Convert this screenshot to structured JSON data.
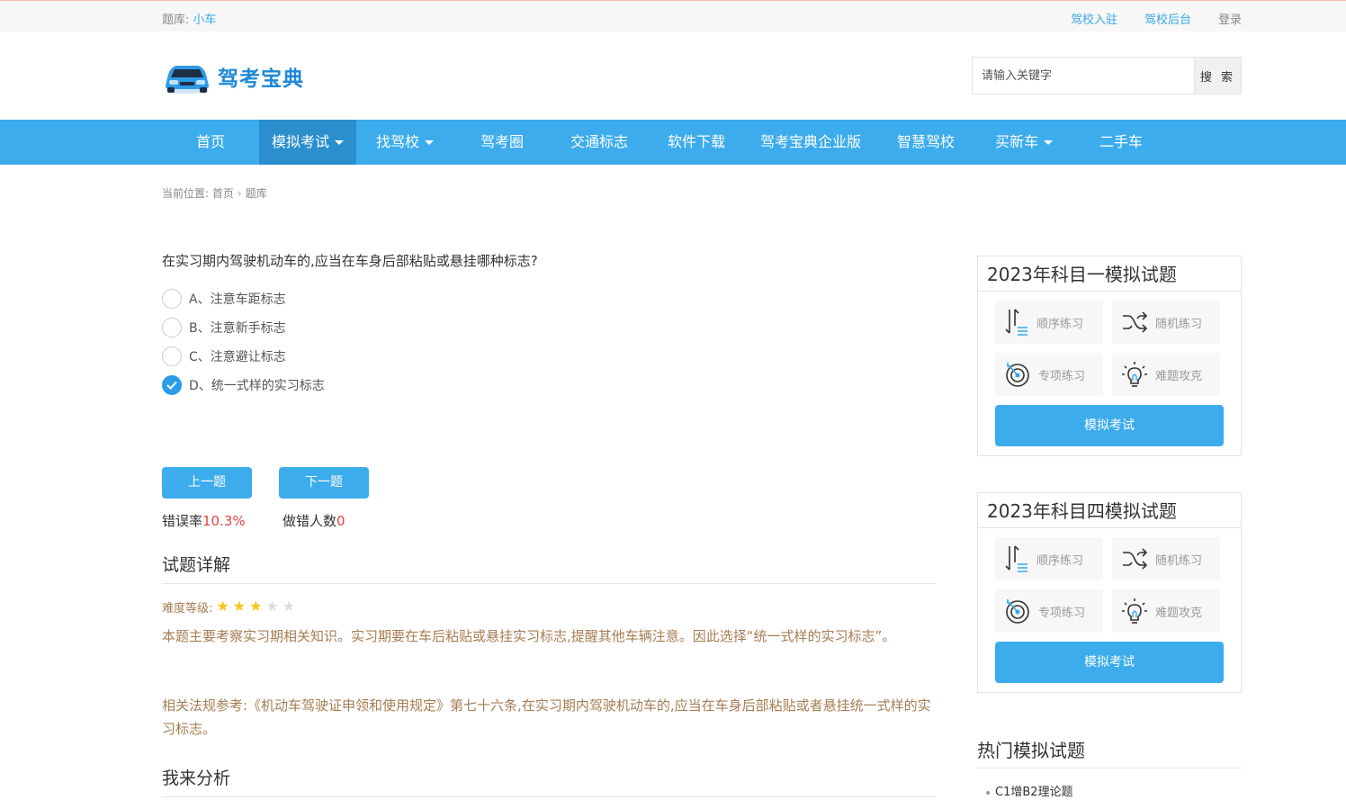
{
  "topbar": {
    "library_label": "题库:",
    "library_value": "小车",
    "links": [
      "驾校入驻",
      "驾校后台"
    ],
    "login": "登录"
  },
  "header": {
    "logo_text": "驾考宝典",
    "search_placeholder": "请输入关键字",
    "search_button": "搜 索"
  },
  "nav": {
    "items": [
      "首页",
      "模拟考试",
      "找驾校",
      "驾考圈",
      "交通标志",
      "软件下载",
      "驾考宝典企业版",
      "智慧驾校",
      "买新车",
      "二手车"
    ]
  },
  "breadcrumb": {
    "prefix": "当前位置:",
    "items": [
      "首页",
      "题库"
    ]
  },
  "question": {
    "text": "在实习期内驾驶机动车的,应当在车身后部粘贴或悬挂哪种标志?",
    "options": [
      "A、注意车距标志",
      "B、注意新手标志",
      "C、注意避让标志",
      "D、统一式样的实习标志"
    ],
    "selected_index": 3
  },
  "buttons": {
    "prev": "上一题",
    "next": "下一题"
  },
  "stats": {
    "error_rate_label": "错误率",
    "error_rate_value": "10.3%",
    "wrong_count_label": "做错人数",
    "wrong_count_value": "0"
  },
  "explain": {
    "title": "试题详解",
    "difficulty_label": "难度等级:",
    "difficulty_stars": 3,
    "difficulty_max": 5,
    "para1": "本题主要考察实习期相关知识。实习期要在车后粘贴或悬挂实习标志,提醒其他车辆注意。因此选择“统一式样的实习标志”。",
    "para2": "相关法规参考:《机动车驾驶证申领和使用规定》第七十六条,在实习期内驾驶机动车的,应当在车身后部粘贴或者悬挂统一式样的实习标志。"
  },
  "analysis": {
    "title": "我来分析"
  },
  "sidebar": {
    "panels": [
      {
        "title": "2023年科目一模拟试题",
        "tiles": [
          "顺序练习",
          "随机练习",
          "专项练习",
          "难题攻克"
        ],
        "exam_button": "模拟考试"
      },
      {
        "title": "2023年科目四模拟试题",
        "tiles": [
          "顺序练习",
          "随机练习",
          "专项练习",
          "难题攻克"
        ],
        "exam_button": "模拟考试"
      }
    ],
    "hot_title": "热门模拟试题",
    "hot_items": [
      "C1增B2理论题"
    ]
  },
  "colors": {
    "primary": "#3dacec",
    "nav_active": "#2b8fce",
    "link": "#37a8e8",
    "explain_text": "#a67c52",
    "error_red": "#e64040",
    "star_on": "#f5c518"
  }
}
